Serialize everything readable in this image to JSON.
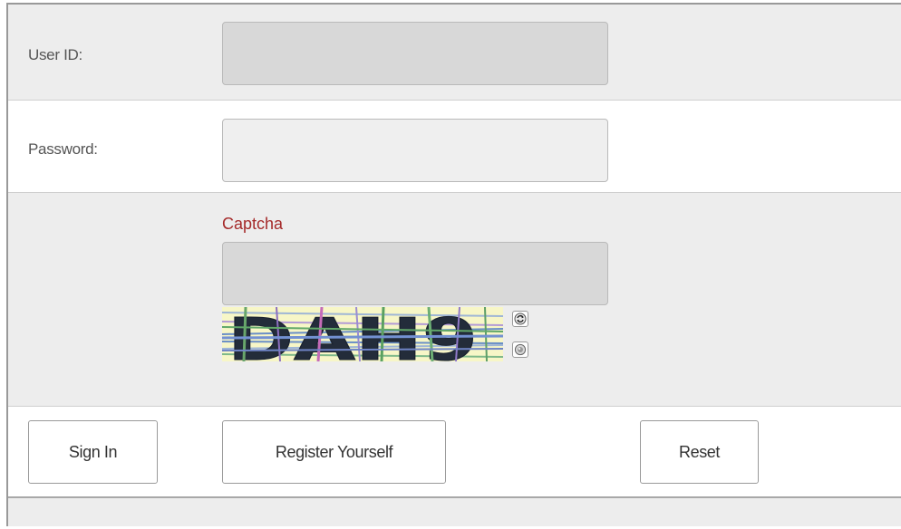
{
  "form": {
    "user_id": {
      "label": "User ID:",
      "value": ""
    },
    "password": {
      "label": "Password:",
      "value": ""
    },
    "captcha": {
      "label": "Captcha",
      "value": "",
      "image_text": "DAH9",
      "refresh_icon": "refresh-icon",
      "audio_icon": "audio-icon"
    }
  },
  "actions": {
    "sign_in": "Sign In",
    "register": "Register Yourself",
    "reset": "Reset"
  },
  "colors": {
    "captcha_label": "#a52a2a",
    "captcha_background": "#f7f6c7"
  }
}
